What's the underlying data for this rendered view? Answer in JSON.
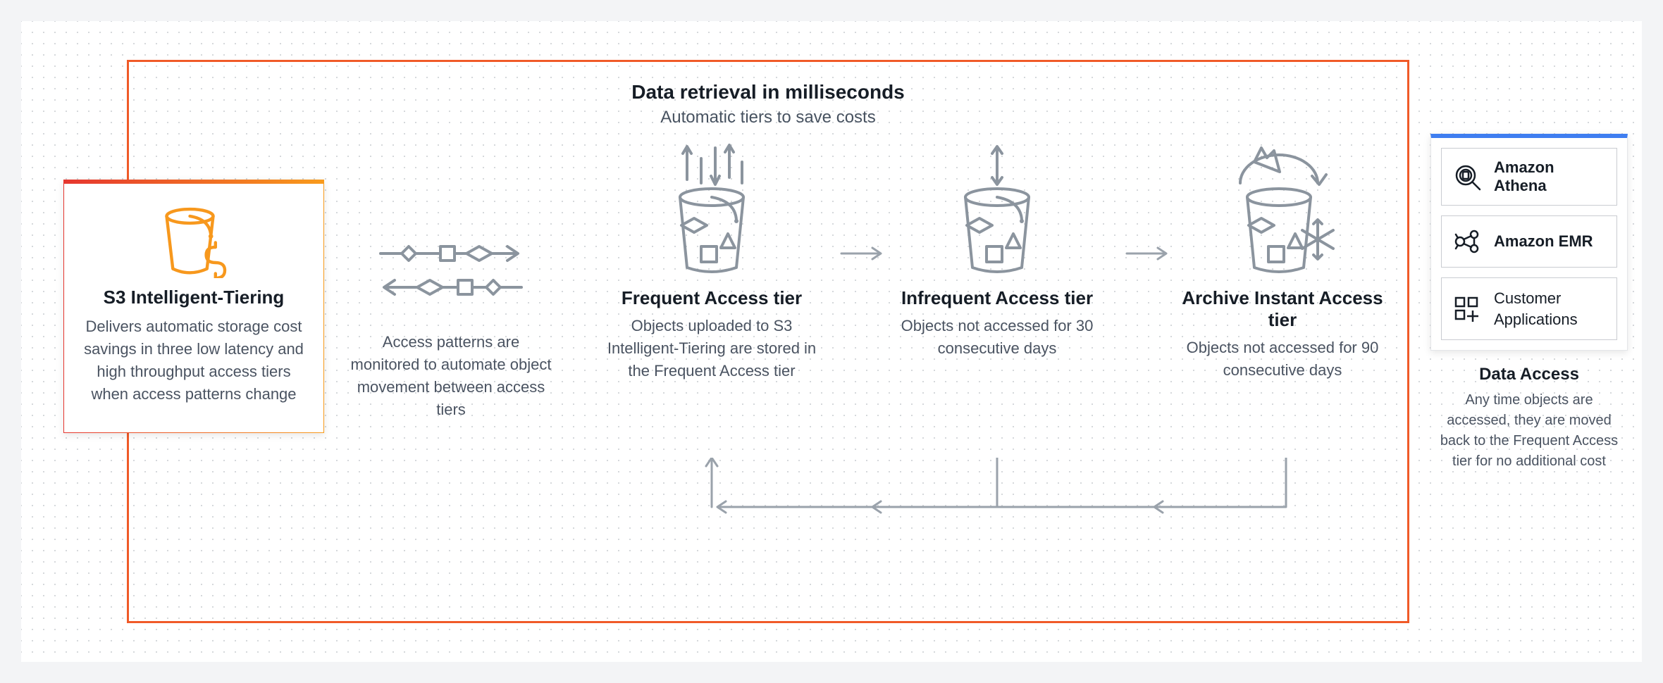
{
  "header": {
    "title": "Data retrieval in milliseconds",
    "subtitle": "Automatic tiers to save costs"
  },
  "card": {
    "title": "S3 Intelligent-Tiering",
    "desc": "Delivers automatic storage cost savings in three low latency and high throughput access tiers when access patterns change"
  },
  "access_patterns": {
    "desc": "Access patterns are monitored to automate object movement between access tiers"
  },
  "tiers": {
    "frequent": {
      "title": "Frequent Access tier",
      "desc": "Objects uploaded to S3 Intelligent-Tiering are stored in the Frequent Access tier"
    },
    "infrequent": {
      "title": "Infrequent Access tier",
      "desc": "Objects not accessed for 30 consecutive days"
    },
    "archive": {
      "title": "Archive Instant Access tier",
      "desc": "Objects not accessed for 90 consecutive days"
    }
  },
  "side": {
    "athena": "Amazon Athena",
    "emr": "Amazon EMR",
    "customer_apps_line1": "Customer",
    "customer_apps_line2": "Applications",
    "data_access_title": "Data Access",
    "data_access_desc": "Any time objects are accessed, they are moved back to the Frequent Access tier for no additional cost"
  }
}
